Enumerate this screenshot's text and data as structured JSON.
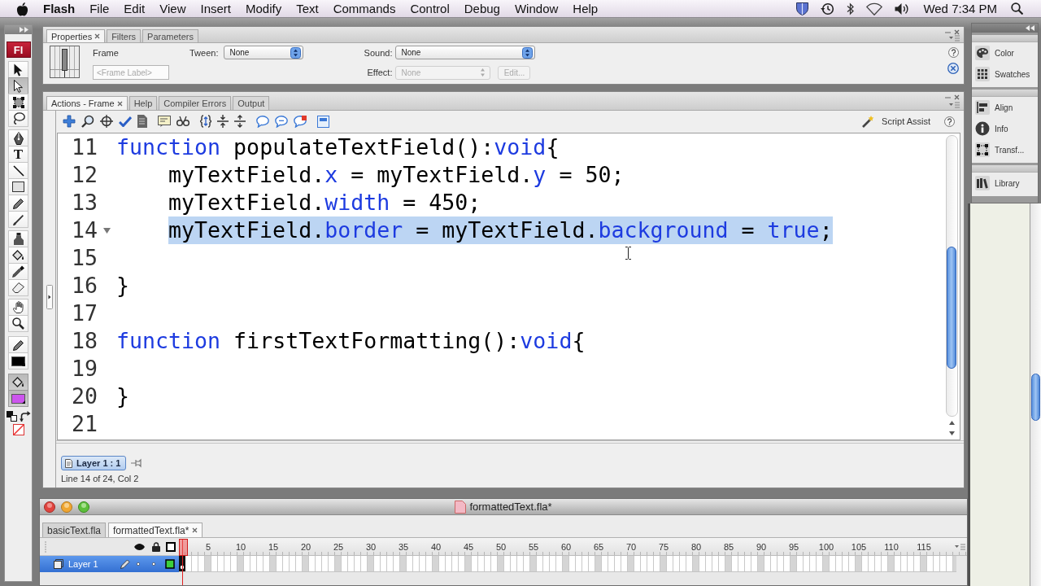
{
  "menu_bar": {
    "app_name": "Flash",
    "items": [
      "File",
      "Edit",
      "View",
      "Insert",
      "Modify",
      "Text",
      "Commands",
      "Control",
      "Debug",
      "Window",
      "Help"
    ],
    "clock": "Wed 7:34 PM"
  },
  "tools_panel": {
    "logo": "Fl",
    "tool_groups": [
      {
        "tools": [
          {
            "kind": "arrow",
            "selected": false
          },
          {
            "kind": "subselect",
            "selected": true
          },
          {
            "kind": "transform",
            "selected": false
          },
          {
            "kind": "lasso",
            "selected": false
          }
        ]
      },
      {
        "tools": [
          {
            "kind": "pen",
            "selected": false
          },
          {
            "kind": "text",
            "glyph": "T",
            "selected": false
          },
          {
            "kind": "line",
            "selected": false
          },
          {
            "kind": "rectangle",
            "selected": false
          },
          {
            "kind": "pencil",
            "selected": false
          },
          {
            "kind": "brush",
            "selected": false
          }
        ]
      },
      {
        "tools": [
          {
            "kind": "inkbottle",
            "selected": false
          },
          {
            "kind": "bucket",
            "selected": false
          },
          {
            "kind": "eyedropper",
            "selected": false
          },
          {
            "kind": "eraser",
            "selected": false
          }
        ]
      },
      {
        "tools": [
          {
            "kind": "hand",
            "selected": false
          },
          {
            "kind": "zoom",
            "selected": false
          }
        ]
      }
    ],
    "color_controls": [
      {
        "kind": "stroke",
        "color": "#000000",
        "selected": false
      },
      {
        "kind": "fill",
        "color": "#cc55ee",
        "selected": true
      }
    ],
    "color_buttons": [
      {
        "kind": "defaults"
      },
      {
        "kind": "swap"
      },
      {
        "kind": "nocolor"
      }
    ]
  },
  "properties_panel": {
    "tabs": [
      {
        "label": "Properties",
        "selected": true
      },
      {
        "label": "Filters",
        "selected": false
      },
      {
        "label": "Parameters",
        "selected": false
      }
    ],
    "heading": "Frame",
    "frame_label_field": {
      "placeholder": "<Frame Label>"
    },
    "tween": {
      "label": "Tween:",
      "value": "None",
      "disabled": false
    },
    "sound": {
      "label": "Sound:",
      "value": "None",
      "disabled": false
    },
    "effect": {
      "label": "Effect:",
      "value": "None",
      "disabled": true
    },
    "edit_button": {
      "label": "Edit...",
      "disabled": true
    }
  },
  "actions_panel": {
    "tabs": [
      {
        "label": "Actions - Frame",
        "selected": true
      },
      {
        "label": "Help",
        "selected": false
      },
      {
        "label": "Compiler Errors",
        "selected": false
      },
      {
        "label": "Output",
        "selected": false
      }
    ],
    "script_assist": "Script Assist",
    "code_lines": [
      {
        "number": "11",
        "collapsible": false,
        "selected": false,
        "tokens": [
          {
            "text": "function",
            "kind": "keyword"
          },
          {
            "text": " populateTextField():",
            "kind": "plain"
          },
          {
            "text": "void",
            "kind": "keyword"
          },
          {
            "text": "{",
            "kind": "plain"
          }
        ],
        "children": [
          {
            "number": "12",
            "collapsible": false,
            "selected": false,
            "tokens": [
              {
                "text": "myTextField.",
                "kind": "plain"
              },
              {
                "text": "x",
                "kind": "keyword"
              },
              {
                "text": " = myTextField.",
                "kind": "plain"
              },
              {
                "text": "y",
                "kind": "keyword"
              },
              {
                "text": " = 50;",
                "kind": "plain"
              }
            ]
          },
          {
            "number": "13",
            "collapsible": false,
            "selected": false,
            "tokens": [
              {
                "text": "myTextField.",
                "kind": "plain"
              },
              {
                "text": "width",
                "kind": "keyword"
              },
              {
                "text": " = 450;",
                "kind": "plain"
              }
            ]
          },
          {
            "number": "14",
            "collapsible": true,
            "selected": true,
            "tokens": [
              {
                "text": "myTextField.",
                "kind": "plain"
              },
              {
                "text": "border",
                "kind": "keyword"
              },
              {
                "text": " = myTextField.",
                "kind": "plain"
              },
              {
                "text": "background",
                "kind": "keyword"
              },
              {
                "text": " = ",
                "kind": "plain"
              },
              {
                "text": "true",
                "kind": "keyword"
              },
              {
                "text": ";",
                "kind": "plain"
              }
            ]
          },
          {
            "number": "15",
            "collapsible": false,
            "selected": false
          }
        ]
      },
      {
        "number": "16",
        "collapsible": false,
        "selected": false,
        "tokens": [
          {
            "text": "}",
            "kind": "plain"
          }
        ]
      },
      {
        "number": "17",
        "collapsible": false,
        "selected": false
      },
      {
        "number": "18",
        "collapsible": false,
        "selected": false,
        "tokens": [
          {
            "text": "function",
            "kind": "keyword"
          },
          {
            "text": " firstTextFormatting():",
            "kind": "plain"
          },
          {
            "text": "void",
            "kind": "keyword"
          },
          {
            "text": "{",
            "kind": "plain"
          }
        ],
        "children": [
          {
            "number": "19",
            "collapsible": false,
            "selected": false
          }
        ]
      },
      {
        "number": "20",
        "collapsible": false,
        "selected": false,
        "tokens": [
          {
            "text": "}",
            "kind": "plain"
          }
        ]
      },
      {
        "number": "21",
        "collapsible": false,
        "selected": false
      }
    ],
    "script_tab": "Layer 1 : 1",
    "status": "Line 14 of 24, Col 2"
  },
  "dock": {
    "groups": [
      {
        "items": [
          {
            "kind": "color",
            "label": "Color"
          },
          {
            "kind": "swatches",
            "label": "Swatches"
          }
        ]
      },
      {
        "items": [
          {
            "kind": "align",
            "label": "Align"
          },
          {
            "kind": "info",
            "label": "Info"
          },
          {
            "kind": "transform",
            "label": "Transf..."
          }
        ]
      },
      {
        "items": [
          {
            "kind": "library",
            "label": "Library"
          }
        ]
      }
    ]
  },
  "timeline": {
    "window_title": "formattedText.fla*",
    "document_tabs": [
      {
        "label": "basicText.fla",
        "selected": false
      },
      {
        "label": "formattedText.fla*",
        "selected": true
      }
    ],
    "ruler": [
      "5",
      "10",
      "15",
      "20",
      "25",
      "30",
      "35",
      "40",
      "45",
      "50",
      "55",
      "60",
      "65",
      "70",
      "75",
      "80",
      "85",
      "90",
      "95",
      "100",
      "105",
      "110",
      "115"
    ],
    "layers": [
      {
        "name": "Layer 1",
        "selected": true
      }
    ]
  }
}
